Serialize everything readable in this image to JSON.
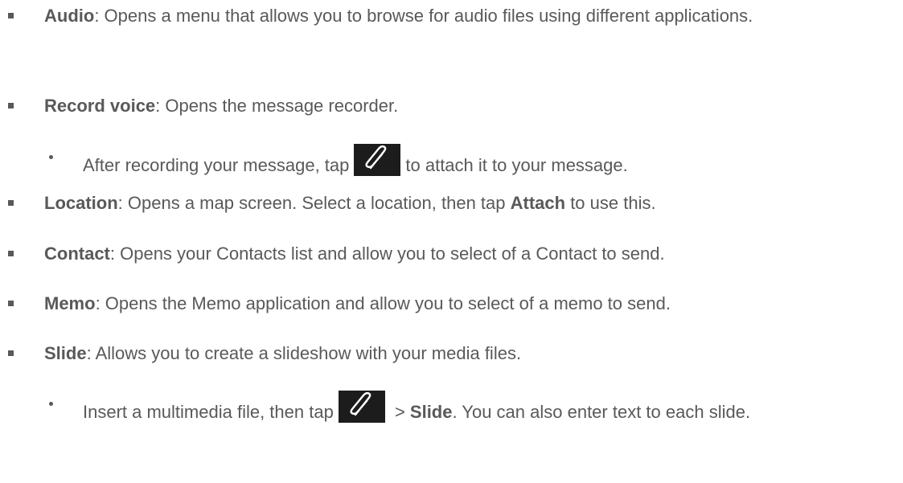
{
  "items": [
    {
      "label": "Audio",
      "desc": ": Opens a menu that allows you to browse for audio files using different applications."
    },
    {
      "label": "Record voice",
      "desc": ": Opens the message recorder."
    },
    {
      "sub_pre": "After recording your message, tap",
      "sub_post": "to attach it to your message."
    },
    {
      "label": "Location",
      "desc_a": ": Opens a map screen. Select a location, then tap ",
      "bold2": "Attach",
      "desc_b": " to use this."
    },
    {
      "label": "Contact",
      "desc": ": Opens your Contacts list and allow you to select of a Contact to send."
    },
    {
      "label": "Memo",
      "desc": ": Opens the Memo application and allow you to select of a memo to send."
    },
    {
      "label": "Slide",
      "desc": ": Allows you to create a slideshow with your media files."
    },
    {
      "sub_pre": "Insert a multimedia file, then tap",
      "sub_mid": " > ",
      "bold2": "Slide",
      "sub_post": ". You can also enter text to each slide."
    }
  ],
  "icons": {
    "attach": "paperclip-icon"
  }
}
